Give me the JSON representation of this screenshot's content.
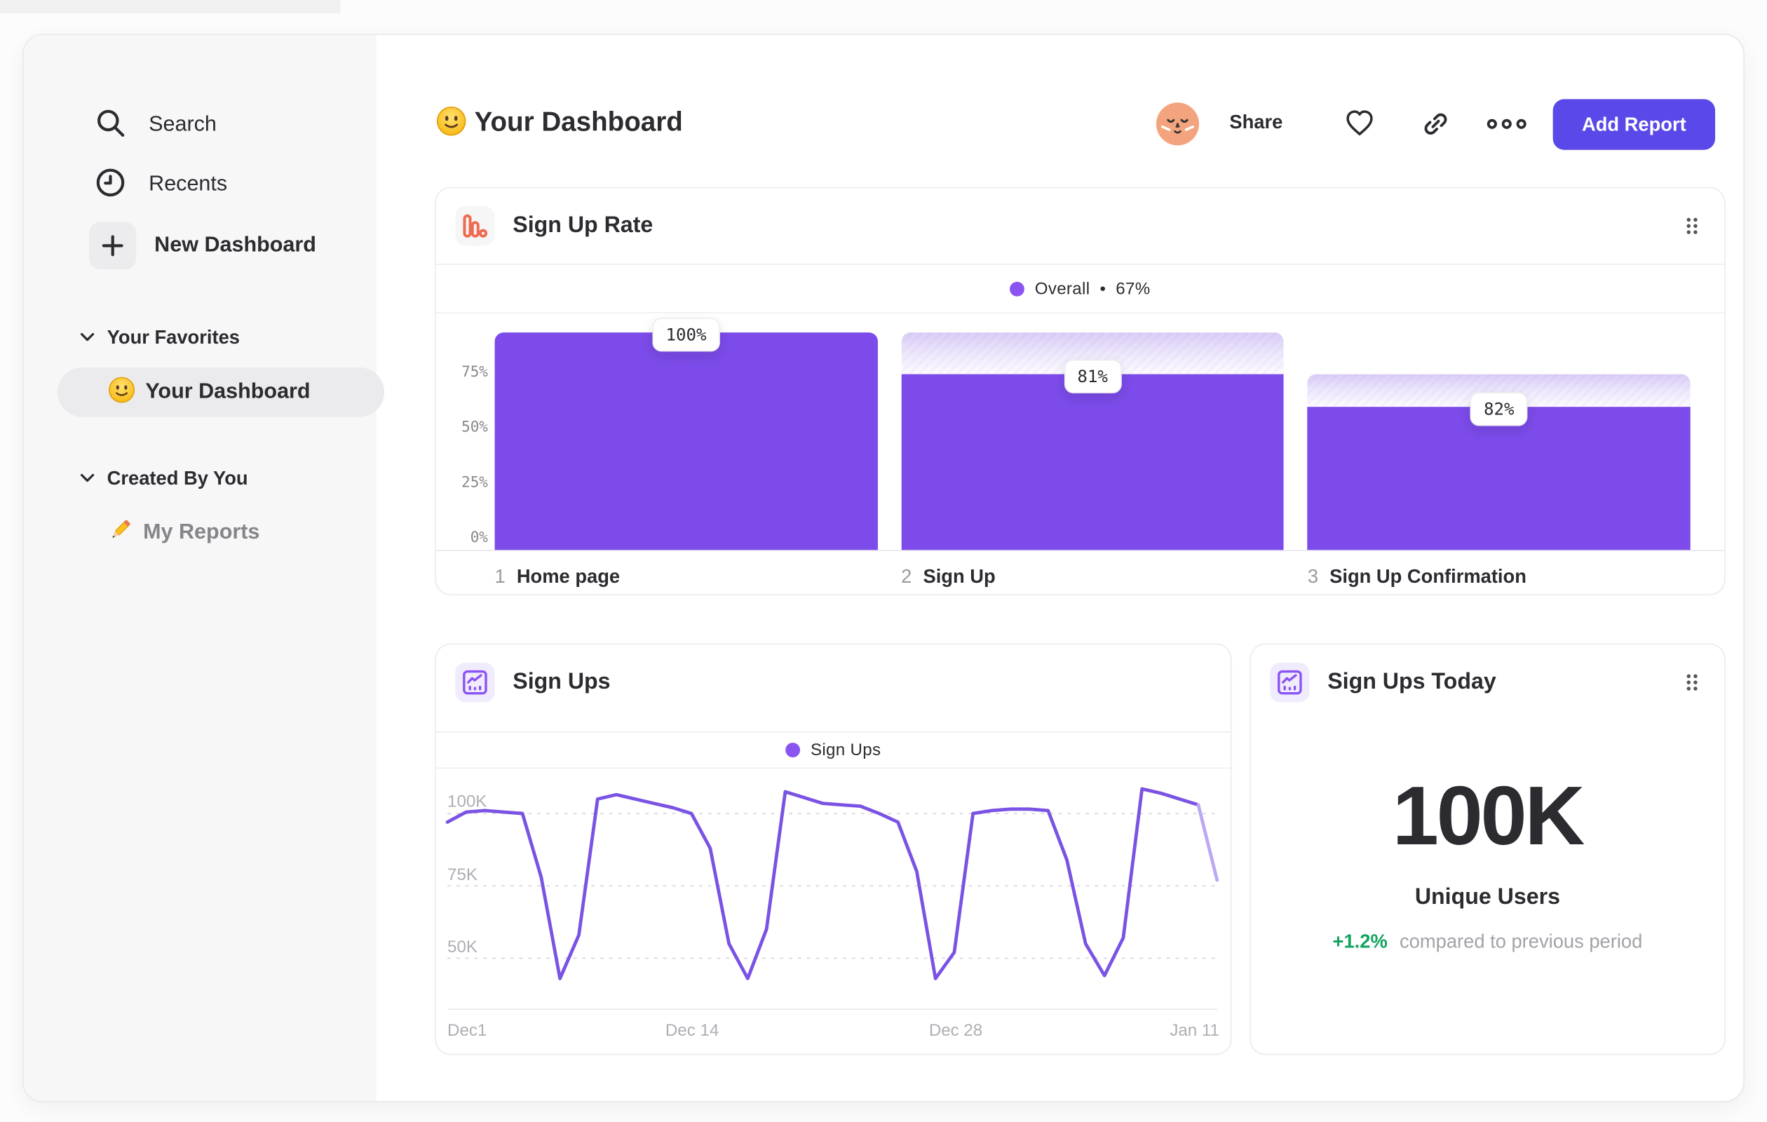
{
  "colors": {
    "accent_purple": "#7c4be9",
    "button_purple": "#5a49e8",
    "line_purple": "#7a52e4",
    "line_purple_light": "#bca8f2",
    "legend_dot": "#8a54f0",
    "icon_orange": "#ee6a50",
    "delta_green": "#12a35f",
    "sidebar_bg": "#f7f7f8"
  },
  "sidebar": {
    "nav": [
      {
        "label": "Search",
        "icon": "search-icon"
      },
      {
        "label": "Recents",
        "icon": "clock-icon"
      },
      {
        "label": "New Dashboard",
        "icon": "plus-icon"
      }
    ],
    "sections": [
      {
        "title": "Your Favorites",
        "items": [
          {
            "label": "Your Dashboard",
            "emoji": "slightly-smiling-face",
            "selected": true
          }
        ]
      },
      {
        "title": "Created By You",
        "items": [
          {
            "label": "My Reports",
            "emoji": "pencil",
            "selected": false
          }
        ]
      }
    ]
  },
  "header": {
    "emoji": "slightly-smiling-face",
    "title": "Your Dashboard",
    "share": "Share",
    "add_report": "Add Report"
  },
  "chart_data": [
    {
      "id": "signup_rate",
      "type": "bar",
      "title": "Sign Up Rate",
      "legend": {
        "name": "Overall",
        "separator": "•",
        "value": "67%"
      },
      "ylabel": "",
      "xlabel": "",
      "ylim": [
        0,
        100
      ],
      "y_ticks": [
        "75%",
        "50%",
        "25%",
        "0%"
      ],
      "steps": [
        {
          "num": "1",
          "label": "Home page",
          "overall_pct": 100,
          "value_label": "100%"
        },
        {
          "num": "2",
          "label": "Sign Up",
          "overall_pct": 81,
          "value_label": "81%"
        },
        {
          "num": "3",
          "label": "Sign Up Confirmation",
          "overall_pct": 66,
          "value_label": "82%"
        }
      ]
    },
    {
      "id": "signups",
      "type": "line",
      "title": "Sign Ups",
      "legend": {
        "name": "Sign Ups"
      },
      "unit": "K",
      "x_ticks": [
        {
          "label": "Dec1",
          "day": 0
        },
        {
          "label": "Dec 14",
          "day": 13
        },
        {
          "label": "Dec 28",
          "day": 27
        },
        {
          "label": "Jan 11",
          "day": 41
        }
      ],
      "y_gridlines": [
        {
          "label": "100K",
          "value": 100
        },
        {
          "label": "75K",
          "value": 75
        },
        {
          "label": "50K",
          "value": 50
        }
      ],
      "values": [
        97,
        100.5,
        101,
        100.5,
        100,
        78,
        43,
        58,
        105,
        106.5,
        105,
        103.5,
        102,
        100,
        88,
        55,
        43,
        60,
        107.5,
        105.5,
        103.5,
        103,
        102.5,
        100,
        97,
        80,
        43,
        52,
        100,
        101,
        101.5,
        101.5,
        101,
        84,
        55,
        44,
        57,
        108.5,
        107,
        105,
        103,
        77
      ],
      "incomplete_tail_points": 1
    },
    {
      "id": "signups_today",
      "type": "kpi",
      "title": "Sign Ups Today",
      "value": "100K",
      "value_sublabel": "Unique Users",
      "delta": "+1.2%",
      "delta_note": "compared to previous period"
    }
  ]
}
